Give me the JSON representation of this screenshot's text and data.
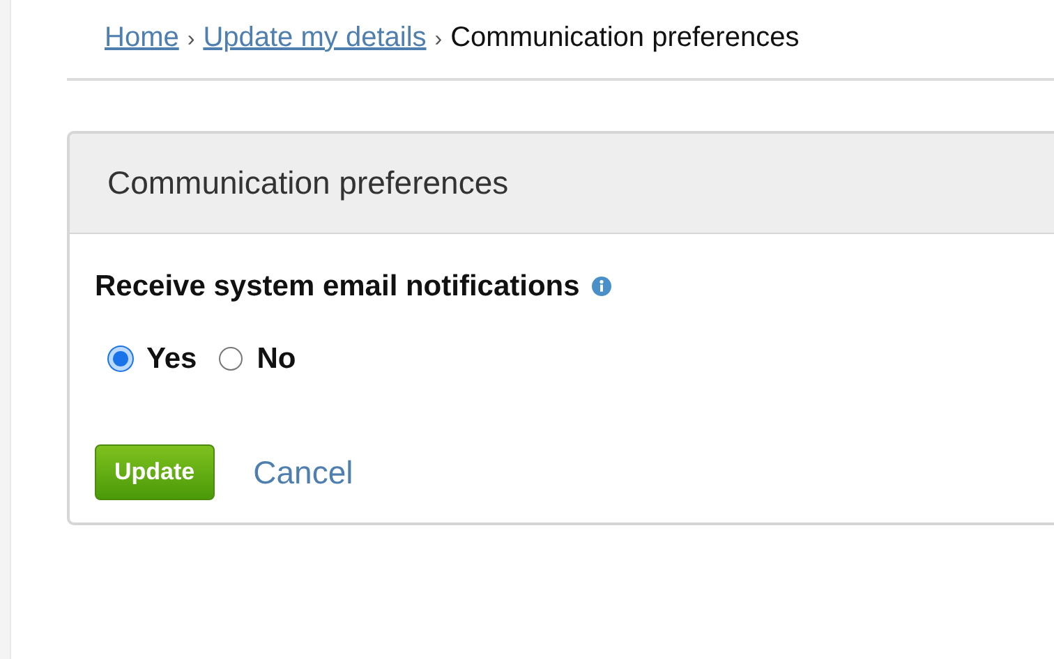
{
  "breadcrumb": [
    {
      "label": "Home",
      "kind": "link"
    },
    {
      "label": "›",
      "kind": "separator"
    },
    {
      "label": "Update my details",
      "kind": "link"
    },
    {
      "label": "›",
      "kind": "separator"
    },
    {
      "label": "Communication preferences",
      "kind": "current"
    }
  ],
  "panel": {
    "title": "Communication preferences",
    "question": "Receive system email notifications",
    "options": [
      {
        "label": "Yes",
        "selected": true
      },
      {
        "label": "No",
        "selected": false
      }
    ],
    "buttons": [
      {
        "label": "Update",
        "kind": "primary"
      },
      {
        "label": "Cancel",
        "kind": "link"
      }
    ]
  }
}
